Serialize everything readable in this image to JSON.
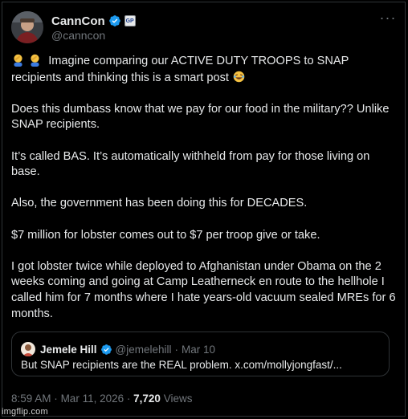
{
  "author": {
    "display_name": "CannCon",
    "handle": "@canncon",
    "affiliate_badge": "GP",
    "more_icon": "ellipsis-icon",
    "verified_color": "#1d9bf0"
  },
  "tweet": {
    "paragraphs": [
      "Imagine comparing our ACTIVE DUTY TROOPS to SNAP recipients and thinking this is a smart post",
      "Does this dumbass know that we pay for our food in the military?? Unlike SNAP recipients.",
      "It’s called BAS.  It’s automatically withheld from pay for those living on base.",
      "Also, the government has been doing this for DECADES.",
      "$7 million for lobster comes out to $7 per troop give or take.",
      "I got lobster twice while deployed to Afghanistan under Obama on the 2 weeks coming and going at Camp Leatherneck en route to the hellhole I called him for 7 months where I hate years-old vacuum sealed MREs for 6 months."
    ]
  },
  "quote": {
    "display_name": "Jemele Hill",
    "handle": "@jemelehill",
    "separator": "·",
    "date": "Mar 10",
    "text": "But SNAP recipients are the REAL problem. x.com/mollyjongfast/..."
  },
  "meta": {
    "time": "8:59 AM",
    "separator1": "·",
    "date": "Mar 11, 2026",
    "separator2": "·",
    "views_count": "7,720",
    "views_label": "Views"
  },
  "watermark": "imgflip.com"
}
